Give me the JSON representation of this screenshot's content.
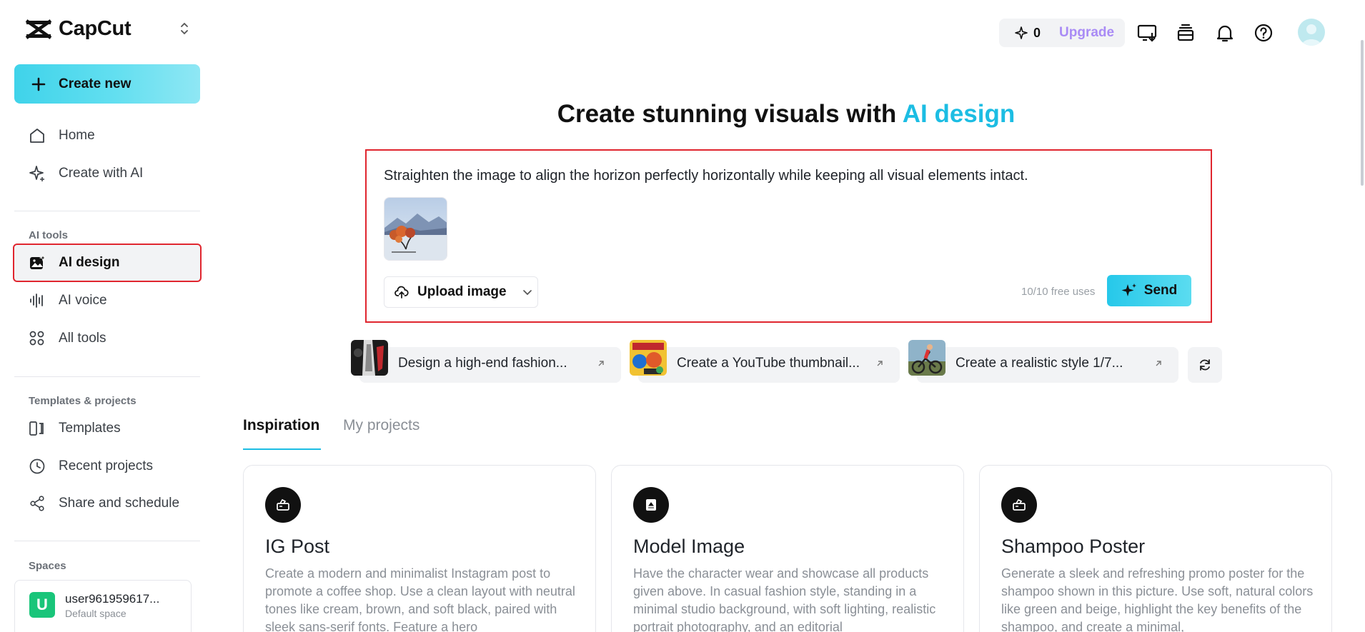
{
  "app": {
    "logo_text": "CapCut"
  },
  "sidebar": {
    "create_new": "Create new",
    "nav_top": [
      {
        "label": "Home"
      },
      {
        "label": "Create with AI"
      }
    ],
    "ai_tools_label": "AI tools",
    "ai_tools": [
      {
        "label": "AI design"
      },
      {
        "label": "AI voice"
      },
      {
        "label": "All tools"
      }
    ],
    "templates_label": "Templates & projects",
    "templates": [
      {
        "label": "Templates"
      },
      {
        "label": "Recent projects"
      },
      {
        "label": "Share and schedule"
      }
    ],
    "spaces_label": "Spaces",
    "space": {
      "initial": "U",
      "name": "user961959617...",
      "subtitle": "Default space"
    }
  },
  "topbar": {
    "credits": "0",
    "upgrade": "Upgrade"
  },
  "main": {
    "headline_prefix": "Create stunning visuals with ",
    "headline_accent": "AI design",
    "prompt": {
      "text": "Straighten the image to align the horizon perfectly horizontally while keeping all visual elements intact.",
      "upload_label": "Upload image",
      "free_uses": "10/10 free uses",
      "send_label": "Send"
    },
    "suggestions": [
      {
        "label": "Design a high-end fashion..."
      },
      {
        "label": "Create a YouTube thumbnail..."
      },
      {
        "label": "Create a realistic style 1/7..."
      }
    ],
    "tabs": [
      {
        "label": "Inspiration",
        "active": true
      },
      {
        "label": "My projects",
        "active": false
      }
    ],
    "cards": [
      {
        "title": "IG Post",
        "description": "Create a modern and minimalist Instagram post to promote a coffee shop. Use a clean layout with neutral tones like cream, brown, and soft black, paired with sleek sans-serif fonts. Feature a hero"
      },
      {
        "title": "Model Image",
        "description": "Have the character wear and showcase all products given above. In casual fashion style, standing in a minimal studio background, with soft lighting, realistic portrait photography, and an editorial"
      },
      {
        "title": "Shampoo Poster",
        "description": "Generate a sleek and refreshing promo poster for the shampoo shown in this picture. Use soft, natural colors like green and beige, highlight the key benefits of the shampoo, and create a minimal,"
      }
    ]
  },
  "colors": {
    "accent": "#1cbde3",
    "highlight_border": "#e0262f",
    "upgrade": "#a98bf5"
  }
}
